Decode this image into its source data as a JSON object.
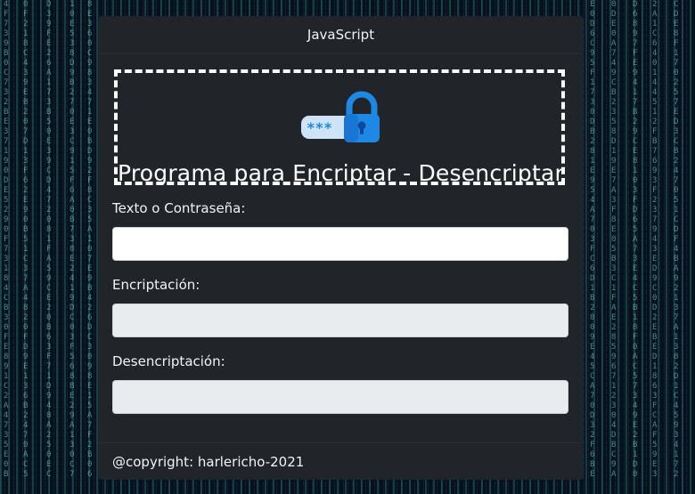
{
  "header": {
    "title": "JavaScript"
  },
  "banner": {
    "title": "Programa para Encriptar - Desencriptar",
    "icon": "password-lock-icon",
    "icon_mask_text": "***"
  },
  "form": {
    "input": {
      "label": "Texto o Contraseña:",
      "value": "",
      "placeholder": ""
    },
    "encrypted": {
      "label": "Encriptación:",
      "value": ""
    },
    "decrypted": {
      "label": "Desencriptación:",
      "value": ""
    }
  },
  "footer": {
    "copyright": "@copyright: harlericho-2021"
  },
  "colors": {
    "card": "#212529",
    "lock_blue": "#1e88e5",
    "lock_light": "#64b5f6",
    "pill": "#cfe3f7",
    "readonly_field": "#e9ecef"
  }
}
